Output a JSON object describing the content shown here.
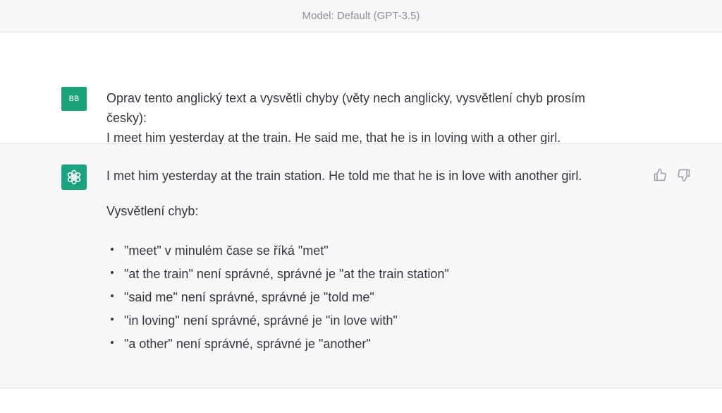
{
  "header": {
    "model_label": "Model: Default (GPT-3.5)"
  },
  "user_message": {
    "avatar_initials": "BB",
    "line1": "Oprav tento anglický text a vysvětli chyby (věty nech anglicky, vysvětlení chyb prosím",
    "line2": "česky):",
    "line3": "I meet him yesterday at the train. He said me, that he is in loving with a other girl."
  },
  "assistant_message": {
    "corrected": "I met him yesterday at the train station. He told me that he is in love with another girl.",
    "explanation_heading": "Vysvětlení chyb:",
    "bullets": [
      "\"meet\" v minulém čase se říká \"met\"",
      "\"at the train\" není správné, správné je \"at the train station\"",
      "\"said me\" není správné, správné je \"told me\"",
      "\"in loving\" není správné, správné je \"in love with\"",
      "\"a other\" není správné, správné je \"another\""
    ],
    "icons": {
      "like": "thumbs-up-icon",
      "dislike": "thumbs-down-icon",
      "avatar": "openai-logo-icon"
    }
  },
  "colors": {
    "avatar_user": "#1aa37a",
    "avatar_ai": "#19a37f",
    "header_text": "#8e8ea0",
    "body_text": "#343541",
    "assistant_bg": "#f7f7f8"
  }
}
